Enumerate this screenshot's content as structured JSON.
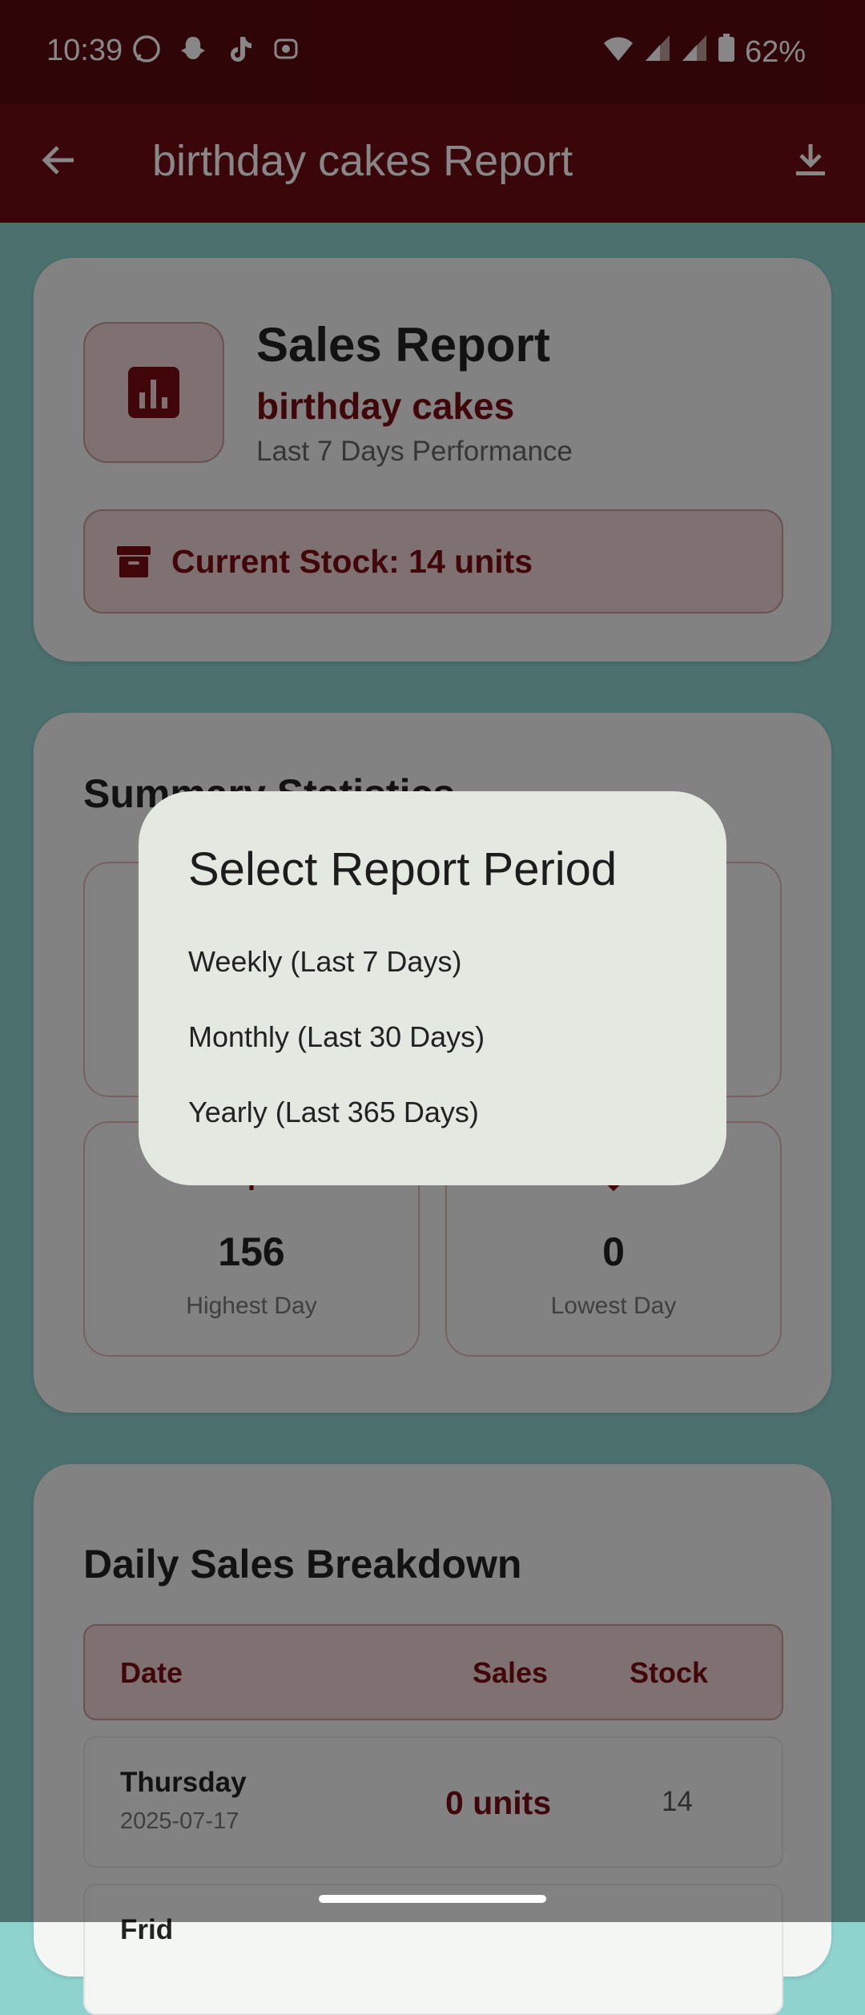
{
  "status_bar": {
    "time": "10:39",
    "battery": "62%",
    "app_icons": [
      "whatsapp-icon",
      "snapchat-icon",
      "tiktok-icon",
      "record-icon"
    ],
    "right_icons": [
      "wifi-icon",
      "signal-icon",
      "signal-icon",
      "battery-icon"
    ]
  },
  "app_bar": {
    "title": "birthday cakes Report",
    "back_icon": "arrow-back-icon",
    "download_icon": "download-icon"
  },
  "header_card": {
    "title": "Sales Report",
    "product": "birthday cakes",
    "subtitle": "Last 7 Days Performance",
    "icon": "bar-chart-icon",
    "stock_text": "Current Stock: 14 units",
    "stock_icon": "inventory-box-icon"
  },
  "summary": {
    "title": "Summary Statistics",
    "highest": {
      "value": "156",
      "label": "Highest Day",
      "icon": "arrow-up-icon"
    },
    "lowest": {
      "value": "0",
      "label": "Lowest Day",
      "icon": "arrow-down-icon"
    }
  },
  "breakdown": {
    "title": "Daily Sales Breakdown",
    "columns": [
      "Date",
      "Sales",
      "Stock"
    ],
    "rows": [
      {
        "day": "Thursday",
        "date": "2025-07-17",
        "sales": "0 units",
        "stock": "14"
      },
      {
        "day": "Frid",
        "date": "",
        "sales": "",
        "stock": ""
      }
    ]
  },
  "dialog": {
    "title": "Select Report Period",
    "options": [
      "Weekly (Last 7 Days)",
      "Monthly (Last 30 Days)",
      "Yearly (Last 365 Days)"
    ]
  },
  "colors": {
    "primary": "#7a0c12",
    "app_bar": "#6e0c12",
    "background": "#8fd3cf",
    "dialog_bg": "#e3e9e1"
  }
}
